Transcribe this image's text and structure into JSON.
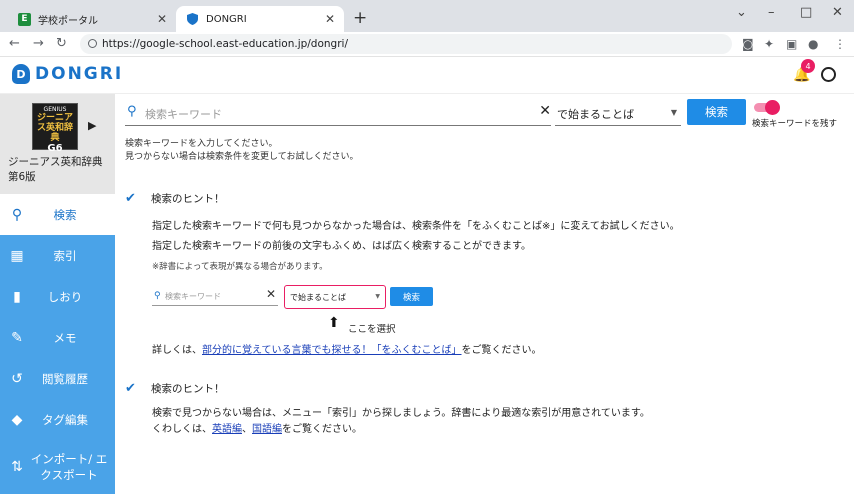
{
  "browser": {
    "tabs": [
      {
        "title": "学校ポータル",
        "favicon": "E"
      },
      {
        "title": "DONGRI",
        "favicon": "shield-icon"
      }
    ],
    "url": "https://google-school.east-education.jp/dongri/"
  },
  "app": {
    "logo_text": "DONGRI",
    "notification_count": "4"
  },
  "sidebar": {
    "dictionary": {
      "cover_brand": "GENIUS",
      "cover_title": "ジーニアス英和辞典",
      "cover_edition": "G6",
      "name": "ジーニアス英和辞典 第6版"
    },
    "items": [
      {
        "label": "検索",
        "icon": "search-icon"
      },
      {
        "label": "索引",
        "icon": "grid-icon"
      },
      {
        "label": "しおり",
        "icon": "bookmark-icon"
      },
      {
        "label": "メモ",
        "icon": "memo-icon"
      },
      {
        "label": "閲覧履歴",
        "icon": "history-icon"
      },
      {
        "label": "タグ編集",
        "icon": "tag-icon"
      },
      {
        "label": "インポート/ エクスポート",
        "icon": "import-export-icon"
      }
    ]
  },
  "search": {
    "placeholder": "検索キーワード",
    "mode": "で始まることば",
    "button": "検索",
    "toggle_label": "検索キーワードを残す",
    "help_line1": "検索キーワードを入力してください。",
    "help_line2": "見つからない場合は検索条件を変更してお試しください。"
  },
  "hint1": {
    "title": "検索のヒント！",
    "line1": "指定した検索キーワードで何も見つからなかった場合は、検索条件を「をふくむことば※」に変えてお試しください。",
    "line2": "指定した検索キーワードの前後の文字もふくめ、はば広く検索することができます。",
    "note": "※辞書によって表現が異なる場合があります。",
    "demo_placeholder": "検索キーワード",
    "demo_mode": "で始まることば",
    "demo_button": "検索",
    "pointer_label": "ここを選択",
    "more_prefix": "詳しくは、",
    "more_link": "部分的に覚えている言葉でも探せる！「をふくむことば」",
    "more_suffix": "をご覧ください。"
  },
  "hint2": {
    "title": "検索のヒント！",
    "line1": "検索で見つからない場合は、メニュー「索引」から探しましょう。辞書により最適な索引が用意されています。",
    "prefix": "くわしくは、",
    "link1": "英語編",
    "sep": "、",
    "link2": "国語編",
    "suffix": "をご覧ください。"
  }
}
